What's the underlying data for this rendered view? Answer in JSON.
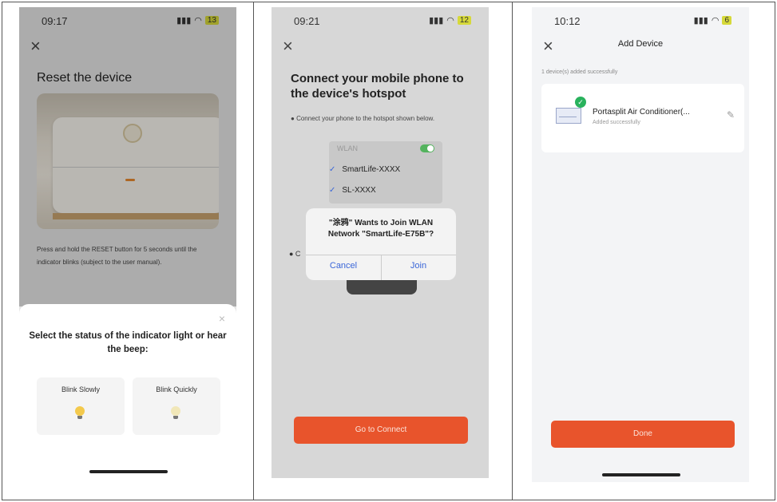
{
  "screen1": {
    "time": "09:17",
    "battery": "13",
    "title": "Reset the device",
    "description": "Press and hold the RESET button for 5 seconds until the indicator blinks (subject to the user manual).",
    "sheet_question": "Select the status of the indicator light or hear the beep:",
    "option_slow": "Blink Slowly",
    "option_quick": "Blink Quickly"
  },
  "screen2": {
    "time": "09:21",
    "battery": "12",
    "title": "Connect your mobile phone to the device's hotspot",
    "instruction": "Connect your phone to the hotspot shown below.",
    "wlan_label": "WLAN",
    "networks": [
      "SmartLife-XXXX",
      "SL-XXXX"
    ],
    "alert_message": "\"涂鸦\" Wants to Join WLAN Network \"SmartLife-E75B\"?",
    "alert_cancel": "Cancel",
    "alert_join": "Join",
    "connect_button": "Go to Connect"
  },
  "screen3": {
    "time": "10:12",
    "battery": "6",
    "header": "Add Device",
    "note": "1 device(s) added successfully",
    "device_name": "Portasplit Air Conditioner(...",
    "device_status": "Added successfully",
    "done_button": "Done"
  }
}
